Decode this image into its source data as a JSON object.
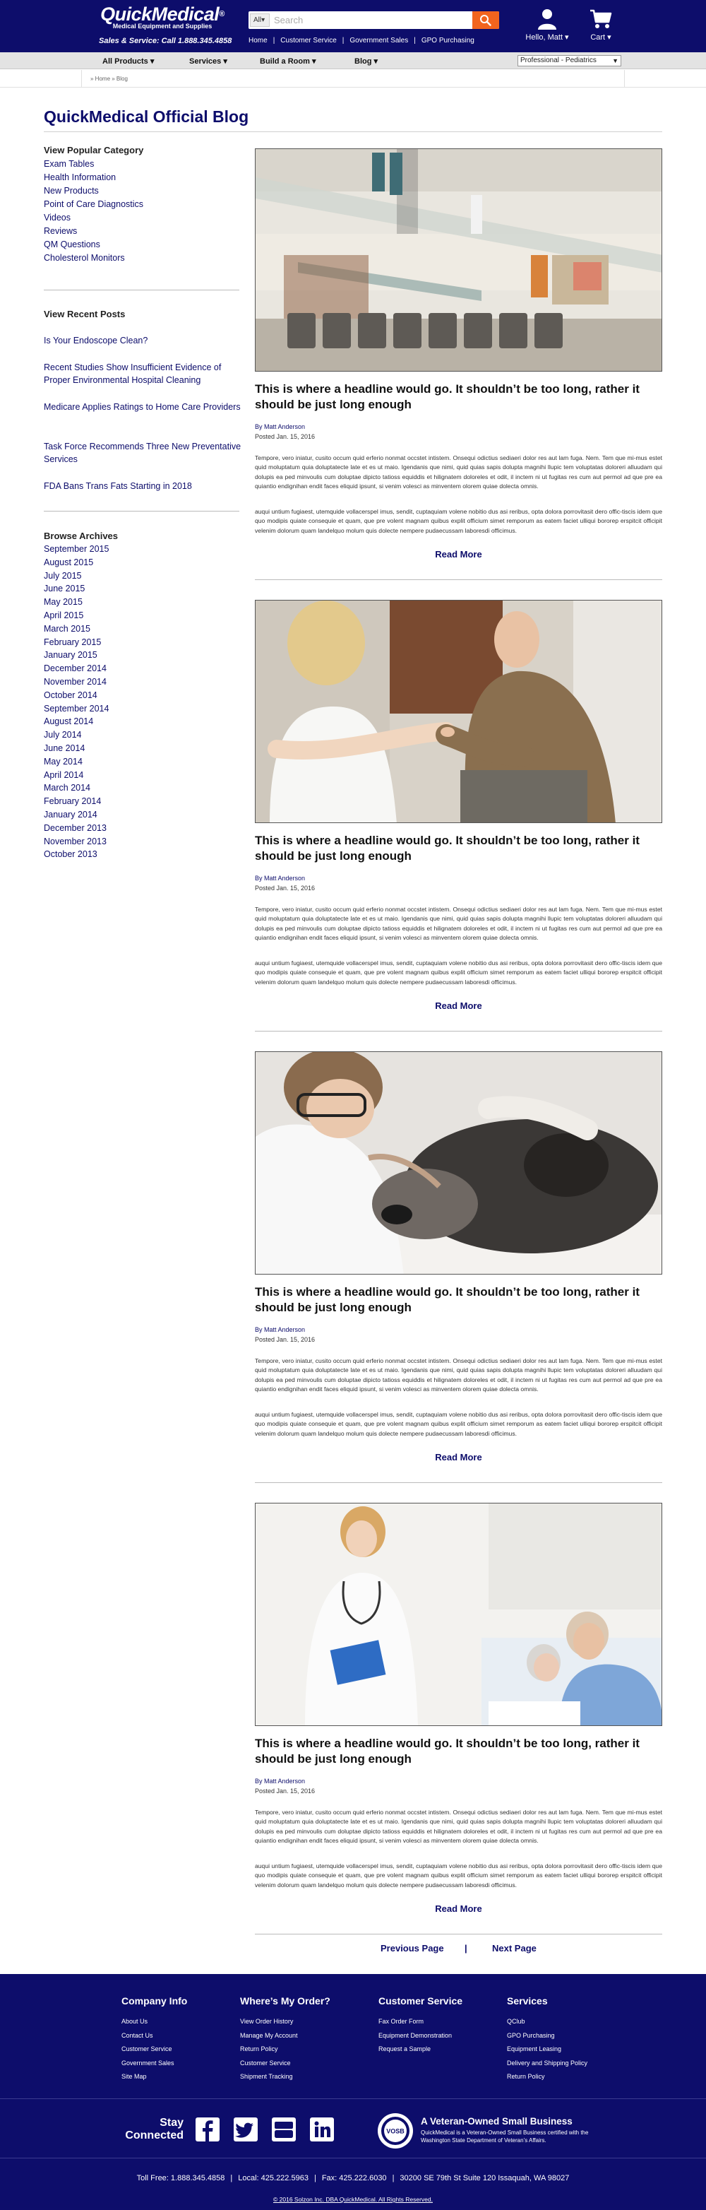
{
  "header": {
    "logo_name": "QuickMedical",
    "logo_reg": "®",
    "logo_tagline": "Medical Equipment and Supplies",
    "phone_line": "Sales & Service: Call 1.888.345.4858",
    "search": {
      "category": "All",
      "placeholder": "Search"
    },
    "nav": [
      "Home",
      "Customer Service",
      "Government Sales",
      "GPO Purchasing"
    ],
    "account_label": "Hello, Matt",
    "cart_label": "Cart",
    "brand_color": "#0d0d6b",
    "accent_color": "#f2641e"
  },
  "category_bar": {
    "items": [
      "All Products",
      "Services",
      "Build a Room",
      "Blog"
    ],
    "select_value": "Professional - Pediatrics"
  },
  "breadcrumb": "» Home » Blog",
  "page_title": "QuickMedical Official Blog",
  "sidebar": {
    "popular_heading": "View Popular Category",
    "categories": [
      "Exam Tables",
      "Health Information",
      "New Products",
      "Point of Care Diagnostics",
      "Videos",
      "Reviews",
      "QM Questions",
      "Cholesterol Monitors"
    ],
    "recent_heading": "View Recent Posts",
    "recent_posts": [
      "Is Your Endoscope Clean?",
      "Recent Studies Show Insufficient Evidence of Proper Environmental Hospital Cleaning",
      "Medicare Applies Ratings to Home Care Providers",
      "Task Force Recommends Three New Preventative Services",
      "FDA Bans Trans Fats Starting in 2018"
    ],
    "archives_heading": "Browse Archives",
    "archives": [
      "September 2015",
      "August 2015",
      "July 2015",
      "June 2015",
      "May 2015",
      "April 2015",
      "March 2015",
      "February 2015",
      "January 2015",
      "December 2014",
      "November 2014",
      "October 2014",
      "September 2014",
      "August 2014",
      "July 2014",
      "June 2014",
      "May 2014",
      "April 2014",
      "March 2014",
      "February 2014",
      "January 2014",
      "December 2013",
      "November 2013",
      "October 2013"
    ]
  },
  "posts": [
    {
      "title": "This is where a headline would go. It shouldn’t be too long, rather it should be just long enough",
      "author": "By Matt Anderson",
      "date": "Posted Jan. 15, 2016",
      "para1": "Tempore, vero iniatur, cusito occum quid erferio nonmat occstet intistem. Onsequi odictius sediaeri dolor res aut lam fuga. Nem. Tem que mi-mus estet quid moluptatum quia doluptatecte late et es ut maio. Igendanis que nimi, quid quias sapis dolupta magnihi llupic tem voluptatas doloreri alluudam qui dolupis ea ped minvoulis cum doluptae dipicto tatioss equiddis et hilignatem doloreles et odit, il inctem ni ut fugitas res cum aut permol ad que pre ea quiantio endignihan endit faces eliquid ipsunt, si venim volesci as minventem olorem quiae dolecta omnis.",
      "para2": "auqui untium fugiaest, utemquide vollacerspel imus, sendit, cuptaquiam volene nobitio dus asi reribus, opta dolora porrovitasit dero offic-tiscis idem que quo modipis quiate consequie et quam, que pre volent magnam quibus explit officium simet remporum as eatem faciet ulliqui bororep erspitcit officipit velenim dolorum quam landelquo molum quis dolecte nempere pudaecussam laboresdi officimus.",
      "read_more": "Read More"
    },
    {
      "title": "This is where a headline would go. It shouldn’t be too long, rather it should be just long enough",
      "author": "By Matt Anderson",
      "date": "Posted Jan. 15, 2016",
      "para1": "Tempore, vero iniatur, cusito occum quid erferio nonmat occstet intistem. Onsequi odictius sediaeri dolor res aut lam fuga. Nem. Tem que mi-mus estet quid moluptatum quia doluptatecte late et es ut maio. Igendanis que nimi, quid quias sapis dolupta magnihi llupic tem voluptatas doloreri alluudam qui dolupis ea ped minvoulis cum doluptae dipicto tatioss equiddis et hilignatem doloreles et odit, il inctem ni ut fugitas res cum aut permol ad que pre ea quiantio endignihan endit faces eliquid ipsunt, si venim volesci as minventem olorem quiae dolecta omnis.",
      "para2": "auqui untium fugiaest, utemquide vollacerspel imus, sendit, cuptaquiam volene nobitio dus asi reribus, opta dolora porrovitasit dero offic-tiscis idem que quo modipis quiate consequie et quam, que pre volent magnam quibus explit officium simet remporum as eatem faciet ulliqui bororep erspitcit officipit velenim dolorum quam landelquo molum quis dolecte nempere pudaecussam laboresdi officimus.",
      "read_more": "Read More"
    },
    {
      "title": "This is where a headline would go. It shouldn’t be too long, rather it should be just long enough",
      "author": "By Matt Anderson",
      "date": "Posted Jan. 15, 2016",
      "para1": "Tempore, vero iniatur, cusito occum quid erferio nonmat occstet intistem. Onsequi odictius sediaeri dolor res aut lam fuga. Nem. Tem que mi-mus estet quid moluptatum quia doluptatecte late et es ut maio. Igendanis que nimi, quid quias sapis dolupta magnihi llupic tem voluptatas doloreri alluudam qui dolupis ea ped minvoulis cum doluptae dipicto tatioss equiddis et hilignatem doloreles et odit, il inctem ni ut fugitas res cum aut permol ad que pre ea quiantio endignihan endit faces eliquid ipsunt, si venim volesci as minventem olorem quiae dolecta omnis.",
      "para2": "auqui untium fugiaest, utemquide vollacerspel imus, sendit, cuptaquiam volene nobitio dus asi reribus, opta dolora porrovitasit dero offic-tiscis idem que quo modipis quiate consequie et quam, que pre volent magnam quibus explit officium simet remporum as eatem faciet ulliqui bororep erspitcit officipit velenim dolorum quam landelquo molum quis dolecte nempere pudaecussam laboresdi officimus.",
      "read_more": "Read More"
    },
    {
      "title": "This is where a headline would go. It shouldn’t be too long, rather it should be just long enough",
      "author": "By Matt Anderson",
      "date": "Posted Jan. 15, 2016",
      "para1": "Tempore, vero iniatur, cusito occum quid erferio nonmat occstet intistem. Onsequi odictius sediaeri dolor res aut lam fuga. Nem. Tem que mi-mus estet quid moluptatum quia doluptatecte late et es ut maio. Igendanis que nimi, quid quias sapis dolupta magnihi llupic tem voluptatas doloreri alluudam qui dolupis ea ped minvoulis cum doluptae dipicto tatioss equiddis et hilignatem doloreles et odit, il inctem ni ut fugitas res cum aut permol ad que pre ea quiantio endignihan endit faces eliquid ipsunt, si venim volesci as minventem olorem quiae dolecta omnis.",
      "para2": "auqui untium fugiaest, utemquide vollacerspel imus, sendit, cuptaquiam volene nobitio dus asi reribus, opta dolora porrovitasit dero offic-tiscis idem que quo modipis quiate consequie et quam, que pre volent magnam quibus explit officium simet remporum as eatem faciet ulliqui bororep erspitcit officipit velenim dolorum quam landelquo molum quis dolecte nempere pudaecussam laboresdi officimus.",
      "read_more": "Read More"
    }
  ],
  "pagination": {
    "previous": "Previous Page",
    "separator": "|",
    "next": "Next Page"
  },
  "footer": {
    "columns": [
      {
        "heading": "Company Info",
        "links": [
          "About Us",
          "Contact Us",
          "Customer Service",
          "Government Sales",
          "Site Map"
        ]
      },
      {
        "heading": "Where’s My Order?",
        "links": [
          "View Order History",
          "Manage My Account",
          "Return Policy",
          "Customer Service",
          "Shipment Tracking"
        ]
      },
      {
        "heading": "Customer Service",
        "links": [
          "Fax Order Form",
          "Equipment Demonstration",
          "Request a Sample"
        ]
      },
      {
        "heading": "Services",
        "links": [
          "QClub",
          "GPO Purchasing",
          "Equipment Leasing",
          "Delivery and Shipping Policy",
          "Return Policy"
        ]
      }
    ],
    "stay_connected": [
      "Stay",
      "Connected"
    ],
    "social_icons": [
      "facebook-icon",
      "twitter-icon",
      "youtube-icon",
      "linkedin-icon"
    ],
    "vosb_seal": "VOSB",
    "vosb_heading": "A Veteran-Owned Small Business",
    "vosb_text": "QuickMedical is a Veteran-Owned Small Business certified with the Washington State Department of Veteran’s Affairs.",
    "contact": {
      "toll_free": "Toll Free: 1.888.345.4858",
      "local": "Local: 425.222.5963",
      "fax": "Fax: 425.222.6030",
      "address": "30200 SE 79th St Suite 120 Issaquah, WA 98027",
      "separator": "|"
    },
    "copyright": "© 2016 Solzon Inc. DBA QuickMedical. All Rights Reserved."
  }
}
